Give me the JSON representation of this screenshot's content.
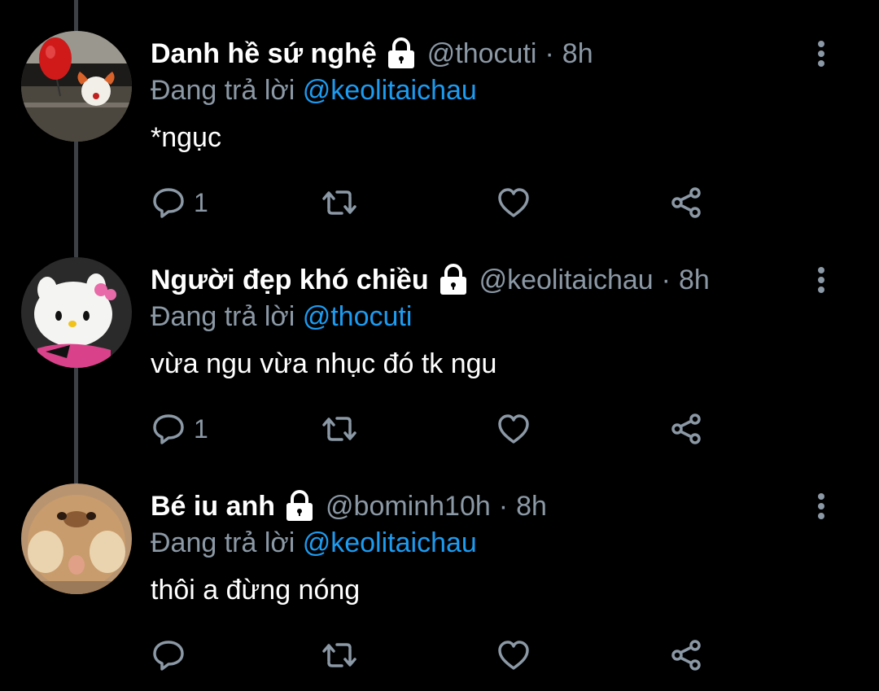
{
  "colors": {
    "background": "#000000",
    "secondary_text": "#8b98a5",
    "mention": "#1d9bf0",
    "thread_line": "#3d4145"
  },
  "tweets": [
    {
      "display_name": "Danh hề sứ nghệ",
      "protected_icon": "lock-icon",
      "handle": "@thocuti",
      "separator": "·",
      "time": "8h",
      "reply_prefix": "Đang trả lời",
      "reply_to": "@keolitaichau",
      "text": "*ngục",
      "reply_count": "1",
      "retweet_count": "",
      "like_count": ""
    },
    {
      "display_name": "Người đẹp khó chiều",
      "protected_icon": "lock-icon",
      "handle": "@keolitaichau",
      "separator": "·",
      "time": "8h",
      "reply_prefix": "Đang trả lời",
      "reply_to": "@thocuti",
      "text": "vừa ngu vừa nhục đó tk ngu",
      "reply_count": "1",
      "retweet_count": "",
      "like_count": ""
    },
    {
      "display_name": "Bé iu anh",
      "protected_icon": "lock-icon",
      "handle": "@bominh10h",
      "separator": "·",
      "time": "8h",
      "reply_prefix": "Đang trả lời",
      "reply_to": "@keolitaichau",
      "text": "thôi a đừng nóng",
      "reply_count": "",
      "retweet_count": "",
      "like_count": ""
    }
  ]
}
